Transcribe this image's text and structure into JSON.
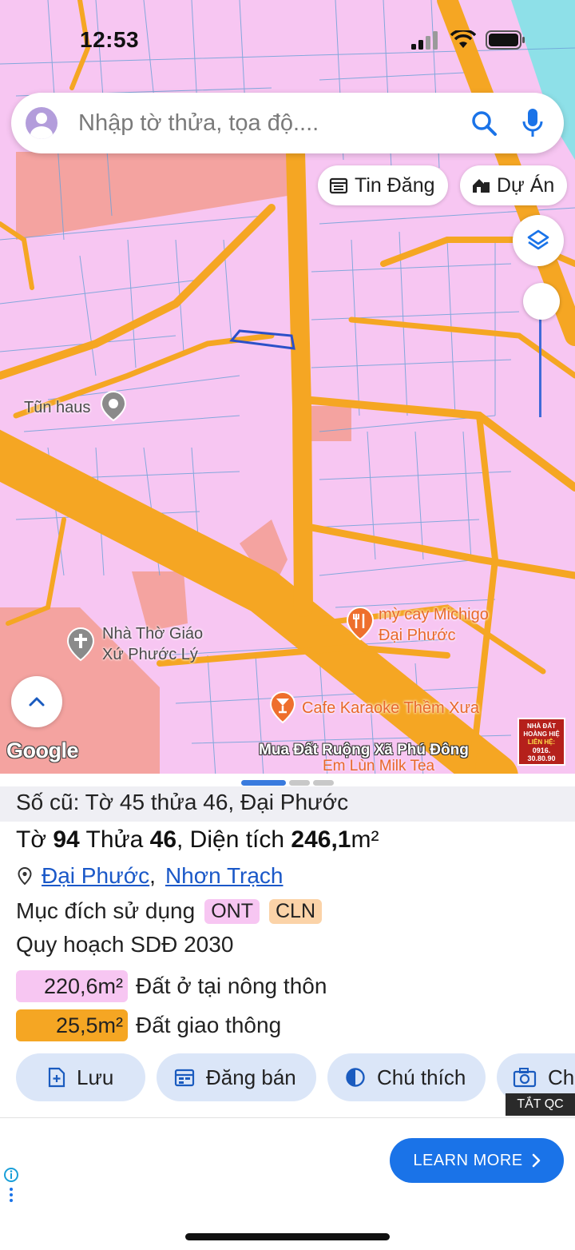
{
  "status_bar": {
    "time": "12:53"
  },
  "search": {
    "placeholder": "Nhập tờ thửa, tọa độ...."
  },
  "chips": {
    "tin_dang": "Tin Đăng",
    "du_an": "Dự Án"
  },
  "map": {
    "google_logo": "Google",
    "banner_text": "Mua Đất Ruộng Xã Phú Đông",
    "places": {
      "tun_haus": "Tũn haus",
      "church_line1": "Nhà Thờ Giáo",
      "church_line2": "Xứ Phước Lý",
      "michigo_line1": "mỳ cay Michigo",
      "michigo_line2": "Đại Phước",
      "cafe": "Cafe Karaoke Thềm Xưa",
      "milk_tea": "Em Lùn Milk Tea"
    },
    "ad_thumb": {
      "line1": "NHÀ ĐẤT HOÀNG HIỆ",
      "line2": "LIÊN HỆ:",
      "line3": "0916. 30.80.90"
    }
  },
  "parcel": {
    "old_number": "Số cũ: Tờ 45 thửa 46, Đại Phước",
    "to_label": "Tờ",
    "to_value": "94",
    "thua_label": "Thửa",
    "thua_value": "46",
    "area_label": ", Diện tích",
    "area_value": "246,1",
    "area_unit": "m²",
    "ward": "Đại Phước",
    "district": "Nhơn Trạch",
    "comma": ",",
    "purpose_label": "Mục đích sử dụng",
    "purpose_tags": [
      "ONT",
      "CLN"
    ],
    "plan_label": "Quy hoạch SDĐ 2030",
    "zones": [
      {
        "area": "220,6m²",
        "label": "Đất ở tại nông thôn",
        "color": "#f7c6f2"
      },
      {
        "area": "25,5m²",
        "label": "Đất giao thông",
        "color": "#f5a623"
      }
    ]
  },
  "actions": {
    "save": "Lưu",
    "sell": "Đăng bán",
    "legend": "Chú thích",
    "capture": "Ch"
  },
  "ad": {
    "hide_label": "TẮT QC",
    "learn_more": "LEARN MORE"
  },
  "colors": {
    "residential": "#f7c6f2",
    "road": "#f5a623",
    "agri": "#f4a3a0",
    "accent_blue": "#1a73e8"
  }
}
